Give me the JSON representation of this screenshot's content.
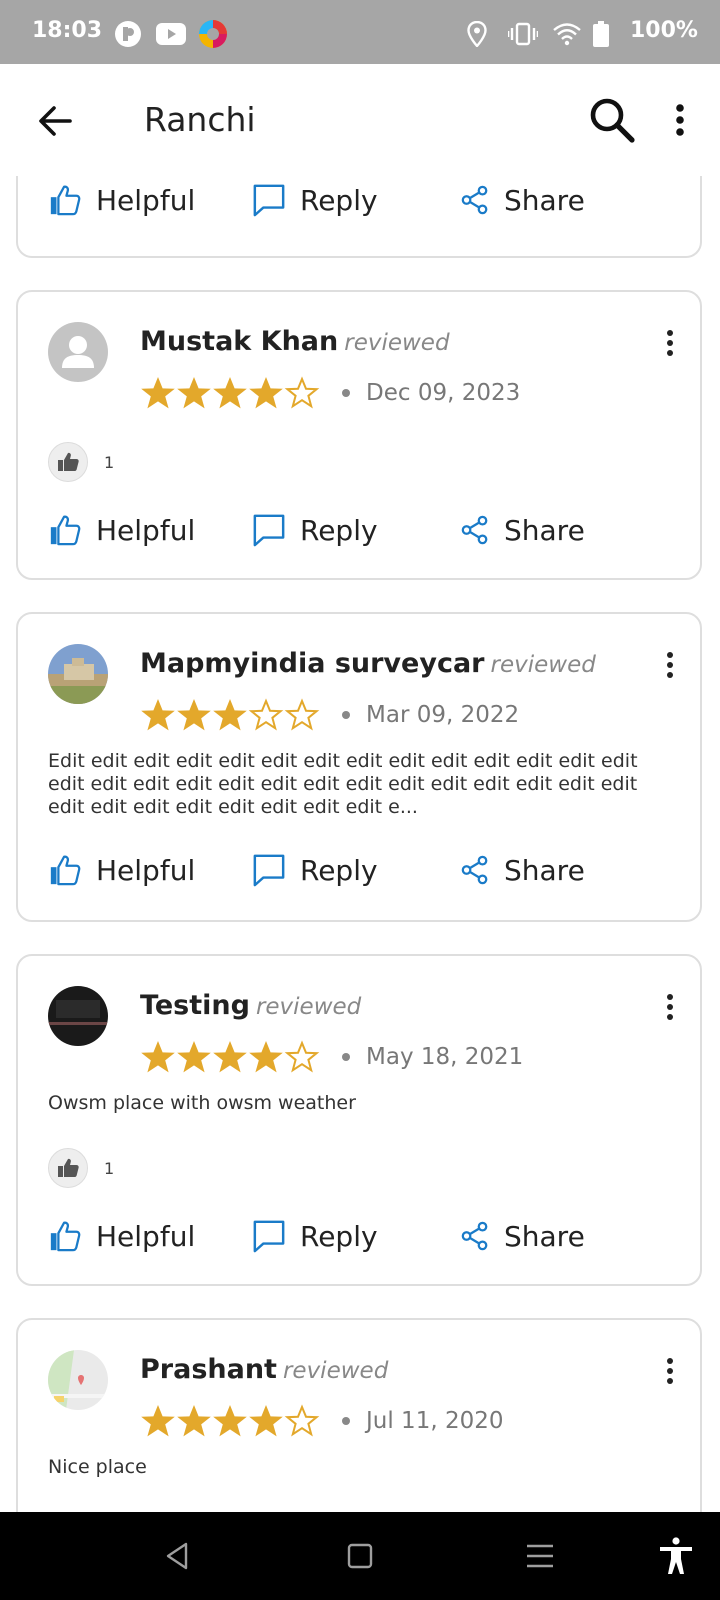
{
  "status_bar": {
    "time": "18:03",
    "battery": "100%"
  },
  "app_bar": {
    "title": "Ranchi"
  },
  "actions": {
    "helpful": "Helpful",
    "reply": "Reply",
    "share": "Share"
  },
  "colors": {
    "star": "#E3A82B",
    "action_icon": "#1A7BC8",
    "star_empty": "#E3A82B"
  },
  "reviews": [
    {
      "name": "Mustak Khan",
      "tag": "reviewed",
      "rating": 4,
      "date": "Dec 09, 2023",
      "text": "",
      "likes": "1"
    },
    {
      "name": "Mapmyindia surveycar",
      "tag": "reviewed",
      "rating": 3,
      "date": "Mar 09, 2022",
      "text": "Edit edit edit edit edit edit edit edit edit edit edit edit edit edit edit edit edit edit edit edit edit edit edit edit edit edit edit edit edit edit edit edit edit edit edit edit e...",
      "likes": ""
    },
    {
      "name": "Testing",
      "tag": "reviewed",
      "rating": 4,
      "date": "May 18, 2021",
      "text": "Owsm place with owsm weather",
      "likes": "1"
    },
    {
      "name": "Prashant",
      "tag": "reviewed",
      "rating": 4,
      "date": "Jul 11, 2020",
      "text": "Nice place",
      "likes": ""
    }
  ]
}
